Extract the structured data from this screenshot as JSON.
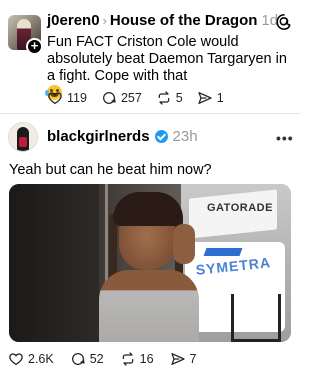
{
  "parent_post": {
    "username": "j0eren0",
    "separator": "›",
    "community": "House of the Dragon",
    "time": "1d",
    "text": "Fun FACT Criston Cole would absolutely beat Daemon Targaryen in a fight. Cope with that",
    "emoji": "laughing-tears-emoji",
    "stats": {
      "likes": "119",
      "replies": "257",
      "reposts": "5",
      "shares": "1"
    }
  },
  "reply_post": {
    "username": "blackgirlnerds",
    "verified": true,
    "time": "23h",
    "more": "•••",
    "text": "Yeah but can he beat him now?",
    "media": {
      "signs": {
        "sign1": "GATORADE",
        "sign2": "SYMETRA"
      }
    },
    "stats": {
      "likes": "2.6K",
      "replies": "52",
      "reposts": "16",
      "shares": "7"
    }
  },
  "colors": {
    "verified": "#1d9bf0",
    "muted_text": "#9a9a9a",
    "divider": "#e4e4e4"
  }
}
